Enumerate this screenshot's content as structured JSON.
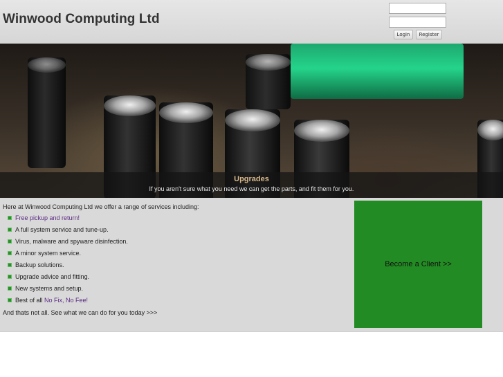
{
  "header": {
    "title": "Winwood Computing Ltd",
    "login_label": "Login",
    "register_label": "Register"
  },
  "banner": {
    "caption_title": "Upgrades",
    "caption_text": "If you aren't sure what you need we can get the parts, and fit them for you."
  },
  "content": {
    "intro": "Here at Winwood Computing Ltd we offer a range of services including:",
    "services": [
      {
        "text": "",
        "link": "Free pickup and return!"
      },
      {
        "text": "A full system service and tune-up.",
        "link": ""
      },
      {
        "text": "Virus, malware and spyware disinfection.",
        "link": ""
      },
      {
        "text": "A minor system service.",
        "link": ""
      },
      {
        "text": "Backup solutions.",
        "link": ""
      },
      {
        "text": "Upgrade advice and fitting.",
        "link": ""
      },
      {
        "text": "New systems and setup.",
        "link": ""
      },
      {
        "text": "Best of all ",
        "link": "No Fix, No Fee!"
      }
    ],
    "outro": "And thats not all. See what we can do for you today >>>",
    "cta": "Become a Client >>"
  },
  "colors": {
    "cta_green": "#238b23",
    "link_purple": "#5a2a82",
    "caption_gold": "#d9b88a",
    "bullet_green": "#2f8c2f"
  },
  "icons": {
    "bullet": "green-square-bullet-icon"
  }
}
